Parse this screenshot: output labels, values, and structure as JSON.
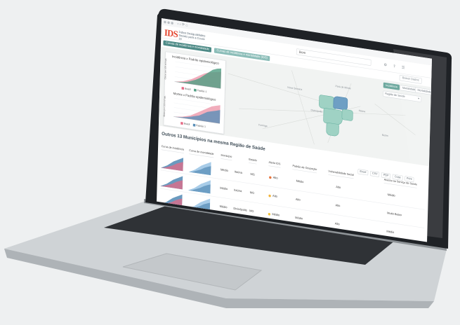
{
  "browser": {
    "tab_icons": "‹ › ⟳ ⌂"
  },
  "header": {
    "logo_text": "IDS",
    "brand_text": "Índice Desigualdades Sociais para a Covid-19",
    "search_value": "Bom",
    "icons": [
      "settings-icon",
      "share-icon",
      "menu-icon"
    ]
  },
  "tabs": [
    {
      "label": "Curvas de incidência e mortalidade"
    },
    {
      "label": "Curvas de incidência e mortalidade (IDS)"
    }
  ],
  "right_button": "Baixar Dados",
  "map": {
    "tabs": [
      {
        "label": "Incidência",
        "active": true
      },
      {
        "label": "Mortalidade",
        "active": false
      },
      {
        "label": "Mortalidade",
        "active": false
      }
    ],
    "region_select": "Região de Saúde",
    "labels": [
      "Pará de Minas",
      "Itaúna",
      "Divinópolis",
      "Nova Serrana",
      "Formiga",
      "Betim"
    ]
  },
  "card": {
    "chart1_title": "Incidência x Padrão epidemiológico",
    "chart2_title": "Mortes x Padrão epidemiológico",
    "legend1": [
      "Brasil",
      "Padrão 1"
    ],
    "legend2": [
      "Brasil",
      "Padrão 1"
    ],
    "y1": "Casos por 100 mil hab.",
    "y2": "Óbitos por 100 mil hab."
  },
  "chart_data": [
    {
      "type": "area",
      "title": "Incidência x Padrão epidemiológico",
      "series": [
        {
          "name": "Brasil",
          "values": [
            0,
            1,
            2,
            4,
            6,
            9,
            12,
            15,
            17,
            18,
            19,
            20
          ]
        },
        {
          "name": "Padrão 1",
          "values": [
            0,
            0.5,
            1,
            2,
            4,
            6,
            9,
            13,
            17,
            21,
            23,
            24
          ]
        }
      ],
      "colors": [
        "#e56a85",
        "#4f9e82"
      ]
    },
    {
      "type": "area",
      "title": "Mortes x Padrão epidemiológico",
      "series": [
        {
          "name": "Brasil",
          "values": [
            0,
            0.5,
            1,
            2,
            3,
            5,
            7,
            9,
            11,
            13,
            14,
            15
          ]
        },
        {
          "name": "Padrão 1",
          "values": [
            0,
            0.3,
            0.6,
            1.2,
            2,
            3,
            4,
            6,
            8,
            9,
            10,
            11
          ]
        }
      ],
      "colors": [
        "#e56a85",
        "#5a8fb8"
      ]
    }
  ],
  "list": {
    "title": "Outros 13 Municípios na mesma Região de Saúde",
    "export_buttons": [
      "Excel",
      "CSV",
      "PDF",
      "Copy",
      "Print"
    ],
    "columns": [
      "Curva de incidência",
      "Curva de mortalidade",
      "Município",
      "Estado",
      "Alerta IDS",
      "Padrão de Ocupação",
      "Vulnerabilidade Social",
      "Vulnerabilidade IDS",
      "Acesso ao Serviço de Saúde"
    ],
    "rows": [
      {
        "ids_value": "Médio",
        "municipio": "Itaúna",
        "estado": "MG",
        "alerta": "Alto",
        "alerta_color": "#e8743b",
        "ocupacao": "Médio",
        "vuln": "Alto",
        "acesso": "Médio"
      },
      {
        "ids_value": "Médio",
        "municipio": "Itaúna",
        "estado": "MG",
        "alerta": "Alto",
        "alerta_color": "#f3b43b",
        "ocupacao": "Alto",
        "vuln": "Alto",
        "acesso": "Muito Baixo"
      },
      {
        "ids_value": "Médio",
        "municipio": "Divinópolis",
        "estado": "MG",
        "alerta": "Médio",
        "alerta_color": "#f3c43b",
        "ocupacao": "Médio",
        "vuln": "Alto",
        "acesso": "Médio"
      }
    ]
  },
  "colors": {
    "accent": "#4d8a86",
    "region_fill": "#9fd2c4",
    "incidence": "#e56a85",
    "mortality": "#5a8fb8"
  }
}
